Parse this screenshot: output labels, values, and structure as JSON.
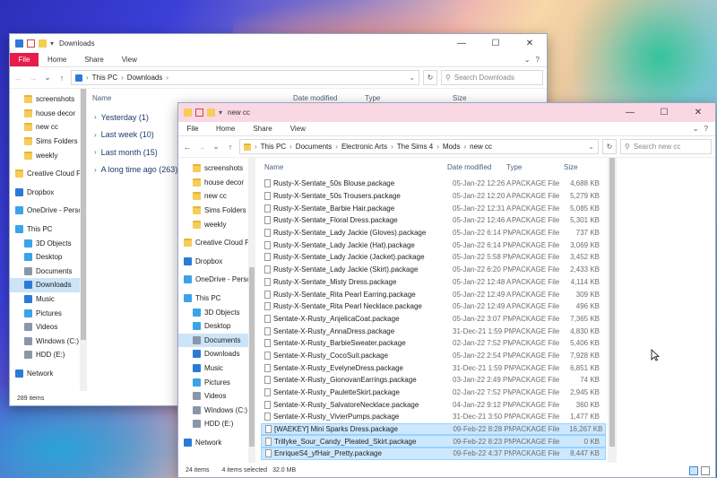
{
  "win1": {
    "title": "Downloads",
    "ribbon": {
      "file": "File",
      "tabs": [
        "Home",
        "Share",
        "View"
      ]
    },
    "address": {
      "crumbs": [
        "This PC",
        "Downloads"
      ]
    },
    "search_placeholder": "Search Downloads",
    "nav": [
      {
        "label": "screenshots",
        "icon": "folder-icon",
        "pinned": true
      },
      {
        "label": "house decor",
        "icon": "folder-icon"
      },
      {
        "label": "new cc",
        "icon": "folder-icon"
      },
      {
        "label": "Sims Folders",
        "icon": "folder-icon"
      },
      {
        "label": "weekly",
        "icon": "folder-icon"
      },
      {
        "label": "Creative Cloud Fil",
        "icon": "folder-icon",
        "level": 0
      },
      {
        "label": "Dropbox",
        "icon": "dropbox-icon",
        "level": 0
      },
      {
        "label": "OneDrive - Persor",
        "icon": "cloud-icon",
        "level": 0
      },
      {
        "label": "This PC",
        "icon": "pc-icon",
        "level": 0
      },
      {
        "label": "3D Objects",
        "icon": "cube-icon"
      },
      {
        "label": "Desktop",
        "icon": "desktop-icon"
      },
      {
        "label": "Documents",
        "icon": "documents-icon"
      },
      {
        "label": "Downloads",
        "icon": "download-icon",
        "selected": true
      },
      {
        "label": "Music",
        "icon": "music-icon"
      },
      {
        "label": "Pictures",
        "icon": "pictures-icon"
      },
      {
        "label": "Videos",
        "icon": "videos-icon"
      },
      {
        "label": "Windows (C:)",
        "icon": "drive-icon"
      },
      {
        "label": "HDD (E:)",
        "icon": "drive-icon"
      },
      {
        "label": "Network",
        "icon": "network-icon",
        "level": 0
      }
    ],
    "columns": {
      "name": "Name",
      "date": "Date modified",
      "type": "Type",
      "size": "Size"
    },
    "groups": [
      "Yesterday (1)",
      "Last week (10)",
      "Last month (15)",
      "A long time ago (263)"
    ],
    "status": {
      "count": "289 items"
    }
  },
  "win2": {
    "title": "new cc",
    "ribbon": {
      "file": "File",
      "tabs": [
        "Home",
        "Share",
        "View"
      ]
    },
    "address": {
      "crumbs": [
        "This PC",
        "Documents",
        "Electronic Arts",
        "The Sims 4",
        "Mods",
        "new cc"
      ]
    },
    "search_placeholder": "Search new cc",
    "nav": [
      {
        "label": "screenshots",
        "icon": "folder-icon"
      },
      {
        "label": "house decor",
        "icon": "folder-icon"
      },
      {
        "label": "new cc",
        "icon": "folder-icon"
      },
      {
        "label": "Sims Folders",
        "icon": "folder-icon"
      },
      {
        "label": "weekly",
        "icon": "folder-icon"
      },
      {
        "label": "Creative Cloud Fil",
        "icon": "folder-icon",
        "level": 0
      },
      {
        "label": "Dropbox",
        "icon": "dropbox-icon",
        "level": 0
      },
      {
        "label": "OneDrive - Persor",
        "icon": "cloud-icon",
        "level": 0
      },
      {
        "label": "This PC",
        "icon": "pc-icon",
        "level": 0
      },
      {
        "label": "3D Objects",
        "icon": "cube-icon"
      },
      {
        "label": "Desktop",
        "icon": "desktop-icon"
      },
      {
        "label": "Documents",
        "icon": "documents-icon",
        "selected": true
      },
      {
        "label": "Downloads",
        "icon": "download-icon"
      },
      {
        "label": "Music",
        "icon": "music-icon"
      },
      {
        "label": "Pictures",
        "icon": "pictures-icon"
      },
      {
        "label": "Videos",
        "icon": "videos-icon"
      },
      {
        "label": "Windows (C:)",
        "icon": "drive-icon"
      },
      {
        "label": "HDD (E:)",
        "icon": "drive-icon"
      },
      {
        "label": "Network",
        "icon": "network-icon",
        "level": 0
      }
    ],
    "columns": {
      "name": "Name",
      "date": "Date modified",
      "type": "Type",
      "size": "Size"
    },
    "files": [
      {
        "name": "Rusty-X-Sentate_50s Blouse.package",
        "date": "05-Jan-22 12:26 AM",
        "type": "PACKAGE File",
        "size": "4,688 KB"
      },
      {
        "name": "Rusty-X-Sentate_50s Trousers.package",
        "date": "05-Jan-22 12:20 AM",
        "type": "PACKAGE File",
        "size": "5,279 KB"
      },
      {
        "name": "Rusty-X-Sentate_Barbie Hair.package",
        "date": "05-Jan-22 12:31 AM",
        "type": "PACKAGE File",
        "size": "5,085 KB"
      },
      {
        "name": "Rusty-X-Sentate_Floral Dress.package",
        "date": "05-Jan-22 12:46 AM",
        "type": "PACKAGE File",
        "size": "5,301 KB"
      },
      {
        "name": "Rusty-X-Sentate_Lady Jackie (Gloves).package",
        "date": "05-Jan-22 6:14 PM",
        "type": "PACKAGE File",
        "size": "737 KB"
      },
      {
        "name": "Rusty-X-Sentate_Lady Jackie (Hat).package",
        "date": "05-Jan-22 6:14 PM",
        "type": "PACKAGE File",
        "size": "3,069 KB"
      },
      {
        "name": "Rusty-X-Sentate_Lady Jackie (Jacket).package",
        "date": "05-Jan-22 5:58 PM",
        "type": "PACKAGE File",
        "size": "3,452 KB"
      },
      {
        "name": "Rusty-X-Sentate_Lady Jackie (Skirt).package",
        "date": "05-Jan-22 6:20 PM",
        "type": "PACKAGE File",
        "size": "2,433 KB"
      },
      {
        "name": "Rusty-X-Sentate_Misty Dress.package",
        "date": "05-Jan-22 12:48 AM",
        "type": "PACKAGE File",
        "size": "4,114 KB"
      },
      {
        "name": "Rusty-X-Sentate_Rita Pearl Earring.package",
        "date": "05-Jan-22 12:49 AM",
        "type": "PACKAGE File",
        "size": "309 KB"
      },
      {
        "name": "Rusty-X-Sentate_Rita Pearl Necklace.package",
        "date": "05-Jan-22 12:49 AM",
        "type": "PACKAGE File",
        "size": "496 KB"
      },
      {
        "name": "Sentate-X-Rusty_AnjelicaCoat.package",
        "date": "05-Jan-22 3:07 PM",
        "type": "PACKAGE File",
        "size": "7,365 KB"
      },
      {
        "name": "Sentate-X-Rusty_AnnaDress.package",
        "date": "31-Dec-21 1:59 PM",
        "type": "PACKAGE File",
        "size": "4,830 KB"
      },
      {
        "name": "Sentate-X-Rusty_BarbieSweater.package",
        "date": "02-Jan-22 7:52 PM",
        "type": "PACKAGE File",
        "size": "5,406 KB"
      },
      {
        "name": "Sentate-X-Rusty_CocoSuit.package",
        "date": "05-Jan-22 2:54 PM",
        "type": "PACKAGE File",
        "size": "7,928 KB"
      },
      {
        "name": "Sentate-X-Rusty_EvelyneDress.package",
        "date": "31-Dec-21 1:59 PM",
        "type": "PACKAGE File",
        "size": "6,851 KB"
      },
      {
        "name": "Sentate-X-Rusty_GionovanEarrings.package",
        "date": "03-Jan-22 2:49 PM",
        "type": "PACKAGE File",
        "size": "74 KB"
      },
      {
        "name": "Sentate-X-Rusty_PauletteSkirt.package",
        "date": "02-Jan-22 7:52 PM",
        "type": "PACKAGE File",
        "size": "2,945 KB"
      },
      {
        "name": "Sentate-X-Rusty_SalvatoreNecklace.package",
        "date": "04-Jan-22 9:12 PM",
        "type": "PACKAGE File",
        "size": "360 KB"
      },
      {
        "name": "Sentate-X-Rusty_VivierPumps.package",
        "date": "31-Dec-21 3:50 PM",
        "type": "PACKAGE File",
        "size": "1,477 KB"
      },
      {
        "name": "[WAEKEY] Mini Sparks Dress.package",
        "date": "09-Feb-22 8:28 PM",
        "type": "PACKAGE File",
        "size": "16,267 KB",
        "selected": true
      },
      {
        "name": "Trillyke_Sour_Candy_Pleated_Skirt.package",
        "date": "09-Feb-22 8:23 PM",
        "type": "PACKAGE File",
        "size": "0 KB",
        "selected": true
      },
      {
        "name": "EnriqueS4_yfHair_Pretty.package",
        "date": "09-Feb-22 4:37 PM",
        "type": "PACKAGE File",
        "size": "8,447 KB",
        "selected": true
      }
    ],
    "status": {
      "count": "24 items",
      "selected": "4 items selected",
      "size": "32.0 MB"
    }
  },
  "colors": {
    "file_tab": "#e81b4b",
    "selection": "#cce8ff",
    "title_pink": "#f9d8e4"
  }
}
